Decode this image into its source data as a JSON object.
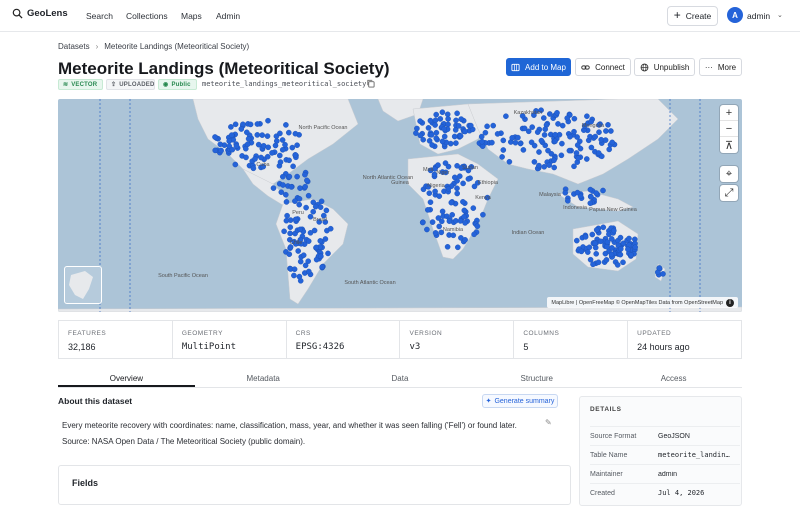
{
  "app": {
    "name": "GeoLens"
  },
  "nav": {
    "links": [
      "Search",
      "Collections",
      "Maps",
      "Admin"
    ],
    "create_label": "Create",
    "user_initial": "A",
    "user_name": "admin"
  },
  "breadcrumb": {
    "root": "Datasets",
    "current": "Meteorite Landings (Meteoritical Society)"
  },
  "dataset": {
    "title": "Meteorite Landings (Meteoritical Society)",
    "badges": {
      "type": "VECTOR",
      "source": "UPLOADED",
      "visibility": "Public"
    },
    "slug": "meteorite_landings_meteoritical_society"
  },
  "actions": {
    "add_to_map": "Add to Map",
    "connect": "Connect",
    "unpublish": "Unpublish",
    "more": "More"
  },
  "map": {
    "attribution": "MapLibre | OpenFreeMap © OpenMapTiles Data from OpenStreetMap",
    "labels": [
      "North Pacific Ocean",
      "North Atlantic Ocean",
      "South Pacific Ocean",
      "South Atlantic Ocean",
      "Kazakhstan",
      "Mongolia",
      "Cuba",
      "Canada",
      "Peru",
      "Brasil",
      "Chile",
      "Mali",
      "Niger",
      "Sudan",
      "Ethiopia",
      "Kenya",
      "Nigeria",
      "Namibia",
      "Malaysia",
      "Indonesia",
      "Guinea",
      "Papua New Guinea",
      "Indian Ocean"
    ],
    "point_color": "#2463d9"
  },
  "stats": [
    {
      "label": "FEATURES",
      "value": "32,186"
    },
    {
      "label": "GEOMETRY",
      "value": "MultiPoint"
    },
    {
      "label": "CRS",
      "value": "EPSG:4326"
    },
    {
      "label": "VERSION",
      "value": "v3"
    },
    {
      "label": "COLUMNS",
      "value": "5"
    },
    {
      "label": "UPDATED",
      "value": "24 hours ago"
    }
  ],
  "tabs": [
    "Overview",
    "Metadata",
    "Data",
    "Structure",
    "Access"
  ],
  "about": {
    "title": "About this dataset",
    "generate_label": "Generate summary",
    "description": "Every meteorite recovery with coordinates: name, classification, mass, year, and whether it was seen falling ('Fell') or found later. Source: NASA Open Data / The Meteoritical Society (public domain)."
  },
  "fields": {
    "title": "Fields"
  },
  "details": {
    "title": "DETAILS",
    "rows": [
      {
        "key": "Source Format",
        "value": "GeoJSON"
      },
      {
        "key": "Table Name",
        "value": "meteorite_landings"
      },
      {
        "key": "Maintainer",
        "value": "admin"
      },
      {
        "key": "Created",
        "value": "Jul 4, 2026"
      }
    ]
  }
}
